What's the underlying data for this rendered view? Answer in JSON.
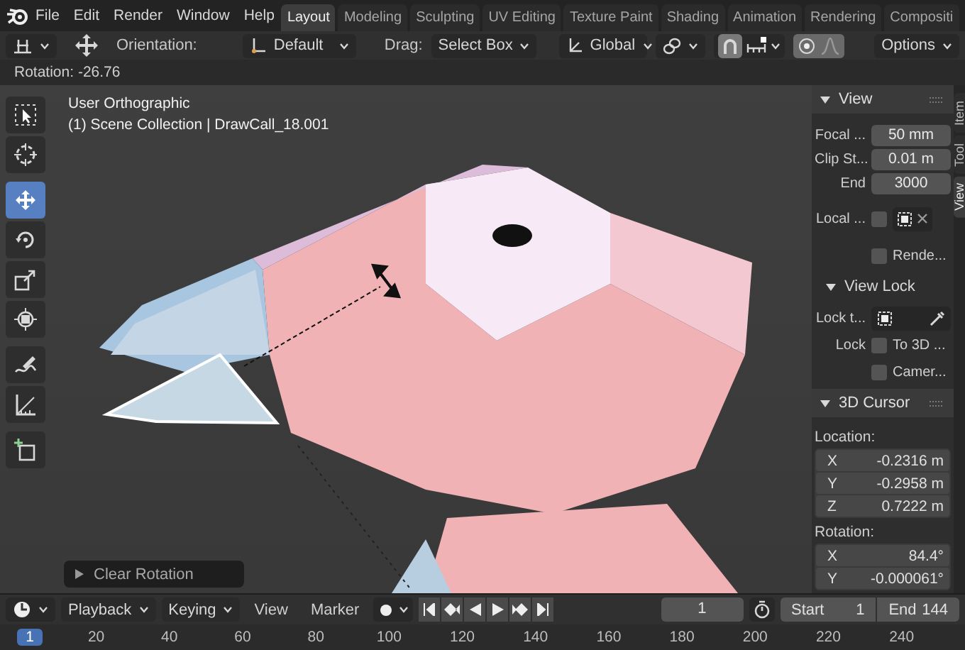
{
  "menus": [
    "File",
    "Edit",
    "Render",
    "Window",
    "Help"
  ],
  "workspaces": [
    {
      "label": "Layout",
      "selected": true
    },
    {
      "label": "Modeling",
      "selected": false
    },
    {
      "label": "Sculpting",
      "selected": false
    },
    {
      "label": "UV Editing",
      "selected": false
    },
    {
      "label": "Texture Paint",
      "selected": false
    },
    {
      "label": "Shading",
      "selected": false
    },
    {
      "label": "Animation",
      "selected": false
    },
    {
      "label": "Rendering",
      "selected": false
    },
    {
      "label": "Compositi",
      "selected": false
    }
  ],
  "tool_header": {
    "orientation_label": "Orientation:",
    "orientation": "Default",
    "drag_label": "Drag:",
    "drag": "Select Box",
    "transform_orientation": "Global",
    "snap": {
      "on": true
    },
    "proportional": {
      "on": true
    },
    "options": "Options"
  },
  "last_operation": "Rotation: -26.76",
  "viewport": {
    "view_name": "User Orthographic",
    "collection": "(1) Scene Collection | DrawCall_18.001"
  },
  "tool_groups": [
    [
      {
        "kind": "select",
        "selected": false
      },
      {
        "kind": "cursor",
        "selected": false
      }
    ],
    [
      {
        "kind": "move",
        "selected": true
      },
      {
        "kind": "rotate",
        "selected": false
      },
      {
        "kind": "scale",
        "selected": false
      },
      {
        "kind": "transform",
        "selected": false
      }
    ],
    [
      {
        "kind": "annotate",
        "selected": false
      },
      {
        "kind": "measure",
        "selected": false
      }
    ],
    [
      {
        "kind": "add_cube",
        "selected": false
      }
    ]
  ],
  "redo_panel": {
    "label": "Clear Rotation",
    "expanded": false
  },
  "sidebar": {
    "tabs": [
      {
        "label": "Item",
        "selected": false
      },
      {
        "label": "Tool",
        "selected": false
      },
      {
        "label": "View",
        "selected": true
      }
    ],
    "panels": [
      {
        "title": "View",
        "expanded": true,
        "rows": [
          {
            "kind": "field",
            "label": "Focal ...",
            "value": "50 mm"
          },
          {
            "kind": "field",
            "label": "Clip St...",
            "value": "0.01 m"
          },
          {
            "kind": "field",
            "label": "End",
            "value": "3000"
          },
          {
            "kind": "local",
            "label": "Local ...",
            "checked": false
          },
          {
            "kind": "checkbox",
            "text": "Rende...",
            "checked": false
          },
          {
            "kind": "subpanel",
            "title": "View Lock",
            "expanded": true
          },
          {
            "kind": "lock_target",
            "label": "Lock t..."
          },
          {
            "kind": "checkbox",
            "label": "Lock",
            "text": "To 3D ...",
            "checked": false
          },
          {
            "kind": "checkbox",
            "text": "Camer...",
            "checked": false
          }
        ]
      },
      {
        "title": "3D Cursor",
        "expanded": true,
        "rows": [
          {
            "kind": "caption",
            "text": "Location:"
          },
          {
            "kind": "vector",
            "items": [
              {
                "axis": "X",
                "value": "-0.2316 m"
              },
              {
                "axis": "Y",
                "value": "-0.2958 m"
              },
              {
                "axis": "Z",
                "value": "0.7222 m"
              }
            ]
          },
          {
            "kind": "caption",
            "text": "Rotation:"
          },
          {
            "kind": "vector",
            "items": [
              {
                "axis": "X",
                "value": "84.4°"
              },
              {
                "axis": "Y",
                "value": "-0.000061°"
              }
            ]
          }
        ]
      }
    ]
  },
  "timeline": {
    "menus": [
      {
        "label": "Playback",
        "dropdown": true
      },
      {
        "label": "Keying",
        "dropdown": true
      },
      {
        "label": "View",
        "dropdown": false
      },
      {
        "label": "Marker",
        "dropdown": false
      }
    ],
    "auto_keying": {
      "on": false
    },
    "current_frame": "1",
    "start_label": "Start",
    "start": "1",
    "end_label": "End",
    "end": "144"
  },
  "ruler": [
    {
      "label": "1",
      "selected": true
    },
    {
      "label": "20",
      "selected": false
    },
    {
      "label": "40",
      "selected": false
    },
    {
      "label": "60",
      "selected": false
    },
    {
      "label": "80",
      "selected": false
    },
    {
      "label": "100",
      "selected": false
    },
    {
      "label": "120",
      "selected": false
    },
    {
      "label": "140",
      "selected": false
    },
    {
      "label": "160",
      "selected": false
    },
    {
      "label": "180",
      "selected": false
    },
    {
      "label": "200",
      "selected": false
    },
    {
      "label": "220",
      "selected": false
    },
    {
      "label": "240",
      "selected": false
    }
  ]
}
